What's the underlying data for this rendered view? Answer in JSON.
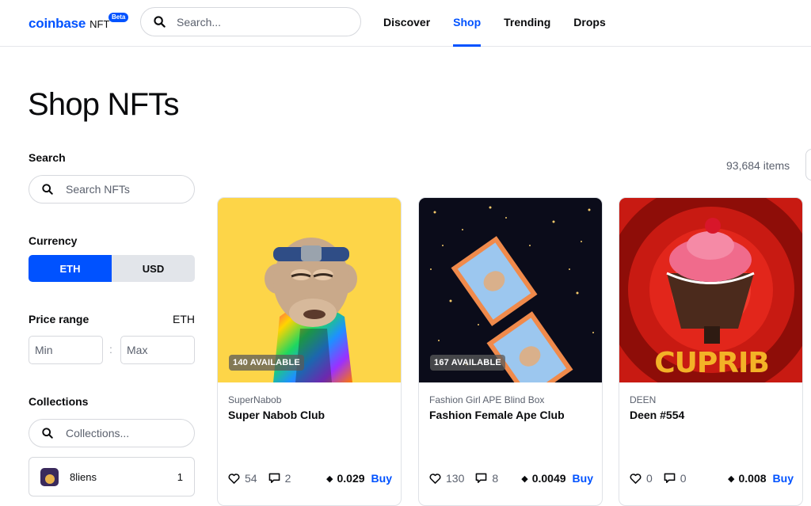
{
  "header": {
    "brand": "coinbase",
    "brand_suffix": "NFT",
    "beta_badge": "Beta",
    "search_placeholder": "Search...",
    "tabs": [
      {
        "label": "Discover",
        "active": false
      },
      {
        "label": "Shop",
        "active": true
      },
      {
        "label": "Trending",
        "active": false
      },
      {
        "label": "Drops",
        "active": false
      }
    ]
  },
  "page": {
    "title": "Shop NFTs",
    "items_count": "93,684 items"
  },
  "sidebar": {
    "search_label": "Search",
    "search_placeholder": "Search NFTs",
    "currency_label": "Currency",
    "currency_options": [
      "ETH",
      "USD"
    ],
    "currency_selected": "ETH",
    "price_label": "Price range",
    "price_unit": "ETH",
    "price_min_placeholder": "Min",
    "price_separator": ":",
    "price_max_placeholder": "Max",
    "collections_label": "Collections",
    "collections_placeholder": "Collections...",
    "collections": [
      {
        "name": "8liens",
        "count": "1"
      }
    ]
  },
  "cards": [
    {
      "availability": "140 AVAILABLE",
      "collection": "SuperNabob",
      "title": "Super Nabob Club",
      "likes": "54",
      "comments": "2",
      "price": "0.029",
      "buy_label": "Buy"
    },
    {
      "availability": "167 AVAILABLE",
      "collection": "Fashion Girl APE Blind Box",
      "title": "Fashion Female Ape Club",
      "likes": "130",
      "comments": "8",
      "price": "0.0049",
      "buy_label": "Buy"
    },
    {
      "availability": "",
      "collection": "DEEN",
      "title": "Deen #554",
      "likes": "0",
      "comments": "0",
      "price": "0.008",
      "buy_label": "Buy"
    }
  ],
  "artwork": {
    "cupcake_text": "CUPRIB"
  },
  "colors": {
    "accent": "#0052ff",
    "card1_bg": "#fdd548",
    "card2_bg": "#0b0c1a",
    "card3_bg": "#c81a12"
  },
  "icons": [
    "search-icon",
    "heart-icon",
    "comment-icon",
    "eth-icon"
  ]
}
